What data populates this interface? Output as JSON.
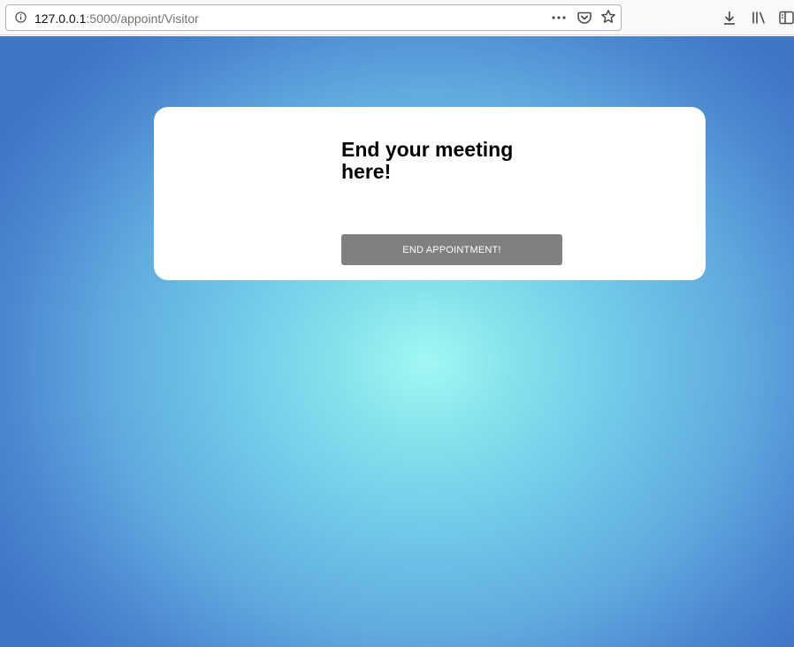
{
  "browser": {
    "url_host": "127.0.0.1",
    "url_path": ":5000/appoint/Visitor",
    "icons": {
      "info": "info-icon",
      "page_actions": "page-actions-icon",
      "pocket": "pocket-icon",
      "bookmark": "bookmark-star-icon",
      "downloads": "download-icon",
      "library": "library-icon",
      "sidebar": "sidebar-icon"
    }
  },
  "page": {
    "heading": "End your meeting here!",
    "end_button_label": "END APPOINTMENT!",
    "colors": {
      "background_center": "#a1f8f3",
      "background_edge": "#3f76c6",
      "card": "#ffffff",
      "button": "#808080",
      "button_text": "#ffffff"
    }
  }
}
